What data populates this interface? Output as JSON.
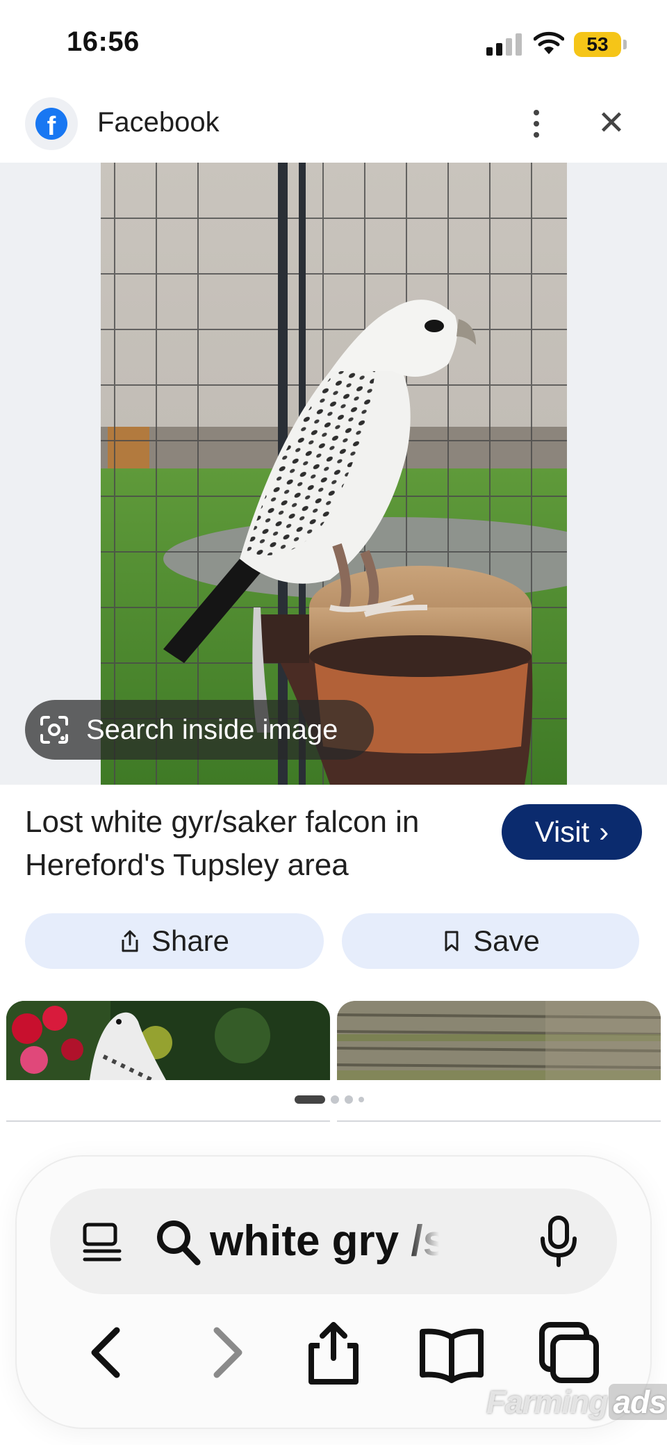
{
  "status_bar": {
    "time": "16:56",
    "battery": "53"
  },
  "header": {
    "site_name": "Facebook",
    "logo_letter": "f"
  },
  "image": {
    "overlay_label": "Search inside image"
  },
  "result": {
    "title": "Lost white gyr/saker falcon in Hereford's Tupsley area",
    "visit_label": "Visit",
    "visit_chevron": "›"
  },
  "actions": {
    "share_label": "Share",
    "save_label": "Save"
  },
  "carousel": {
    "page_count": 4,
    "current_page": 1
  },
  "search_bar": {
    "query": "white gry /saker"
  },
  "watermark": {
    "text_a": "Farming",
    "text_b": "ads"
  },
  "colors": {
    "accent": "#0b2b6e",
    "pill_bg": "#e6edfb",
    "facebook_blue": "#1877f2",
    "battery": "#f5c518"
  }
}
